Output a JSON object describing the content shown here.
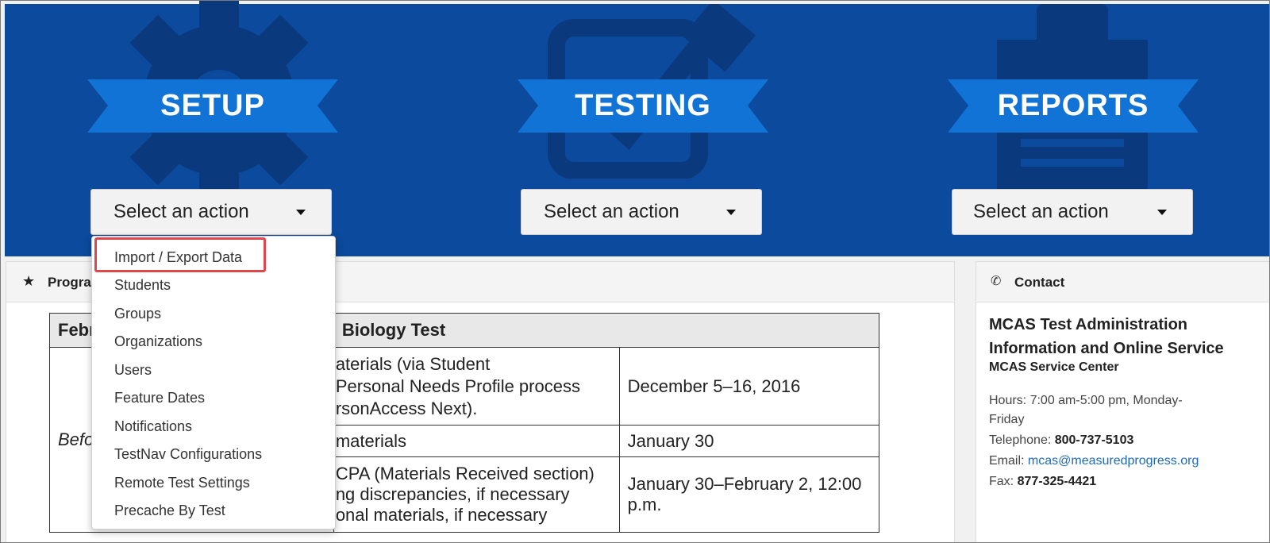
{
  "sections": [
    {
      "title": "SETUP",
      "icon": "gear-icon",
      "action": "Select an action"
    },
    {
      "title": "TESTING",
      "icon": "checkbox-icon",
      "action": "Select an action"
    },
    {
      "title": "REPORTS",
      "icon": "clipboard-icon",
      "action": "Select an action"
    }
  ],
  "menu": {
    "items": [
      "Import / Export Data",
      "Students",
      "Groups",
      "Organizations",
      "Users",
      "Feature Dates",
      "Notifications",
      "TestNav Configurations",
      "Remote Test Settings",
      "Precache By Test"
    ],
    "highlighted": "Import / Export Data"
  },
  "program_panel": {
    "title_visible": "Progra",
    "table": {
      "header_left": "Febr",
      "header_right": "Biology Test",
      "row_label": "Befo",
      "rows": [
        {
          "task": [
            "aterials (via Student",
            "Personal Needs Profile process",
            "rsonAccess Next)."
          ],
          "date": "December 5–16, 2016"
        },
        {
          "task": [
            "materials"
          ],
          "date": "January 30"
        },
        {
          "task": [
            "CPA (Materials Received section)",
            "ng discrepancies, if necessary",
            "onal materials, if necessary"
          ],
          "date": "January 30–February 2, 12:00 p.m."
        }
      ]
    }
  },
  "contact": {
    "title": "Contact",
    "org_line1": "MCAS Test Administration",
    "org_line2": "Information and Online Service",
    "service_center": "MCAS Service Center",
    "hours_label": "Hours: 7:00 am-5:00 pm, Monday-",
    "hours_cont": "Friday",
    "telephone_label": "Telephone: ",
    "telephone": "800-737-5103",
    "email_label": "Email: ",
    "email": "mcas@measuredprogress.org",
    "fax_label": "Fax: ",
    "fax": "877-325-4421"
  },
  "colors": {
    "hero": "#0b4a9c",
    "ribbon": "#1273d6",
    "highlight": "#e0474c",
    "link": "#1e6ab8"
  }
}
